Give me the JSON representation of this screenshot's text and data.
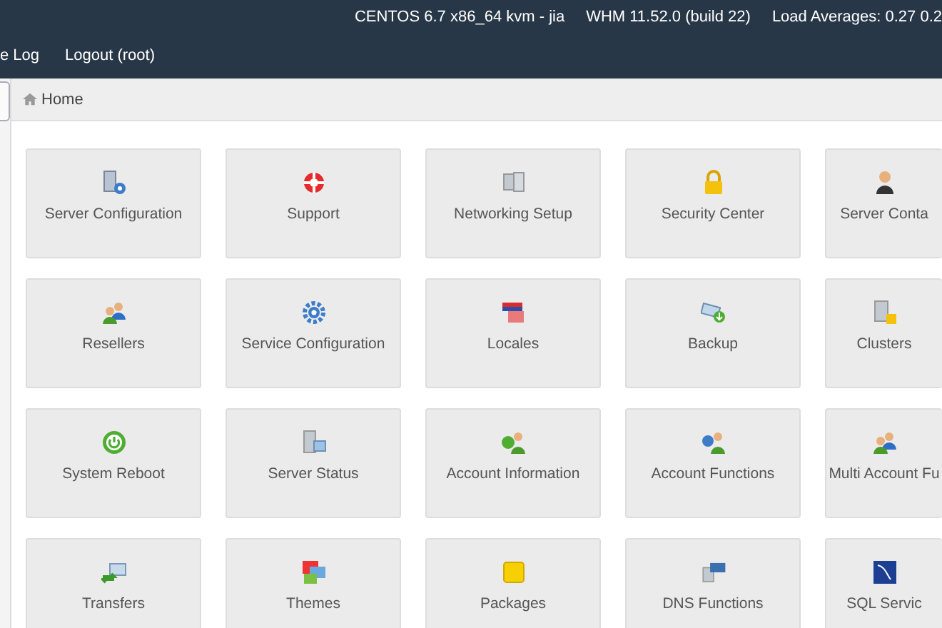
{
  "top_bar": {
    "system_info": [
      "CENTOS 6.7 x86_64 kvm - jia",
      "WHM 11.52.0 (build 22)",
      "Load Averages: 0.27 0.2"
    ],
    "nav_links": [
      "e Log",
      "Logout (root)"
    ]
  },
  "breadcrumb": {
    "label": "Home"
  },
  "tiles": [
    {
      "label": "Server Configuration"
    },
    {
      "label": "Support"
    },
    {
      "label": "Networking Setup"
    },
    {
      "label": "Security Center"
    },
    {
      "label": "Server Conta"
    },
    {
      "label": "Resellers"
    },
    {
      "label": "Service Configuration"
    },
    {
      "label": "Locales"
    },
    {
      "label": "Backup"
    },
    {
      "label": "Clusters"
    },
    {
      "label": "System Reboot"
    },
    {
      "label": "Server Status"
    },
    {
      "label": "Account Information"
    },
    {
      "label": "Account Functions"
    },
    {
      "label": "Multi Account Fu"
    },
    {
      "label": "Transfers"
    },
    {
      "label": "Themes"
    },
    {
      "label": "Packages"
    },
    {
      "label": "DNS Functions"
    },
    {
      "label": "SQL Servic"
    }
  ]
}
